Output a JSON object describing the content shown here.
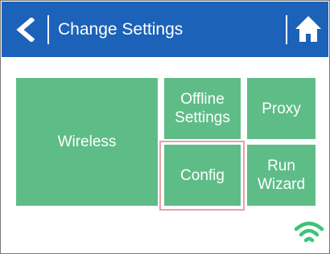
{
  "header": {
    "title": "Change Settings"
  },
  "tiles": {
    "wireless": "Wireless",
    "offline": "Offline Settings",
    "proxy": "Proxy",
    "config": "Config",
    "run_wizard": "Run Wizard"
  },
  "status": {
    "wifi_icon": "wifi-icon",
    "wifi_color": "#3dc37a"
  },
  "colors": {
    "header_bg": "#1c62b8",
    "tile_bg": "#5ebd87",
    "focus_ring": "#e3a3a8"
  },
  "selected_tile": "config"
}
